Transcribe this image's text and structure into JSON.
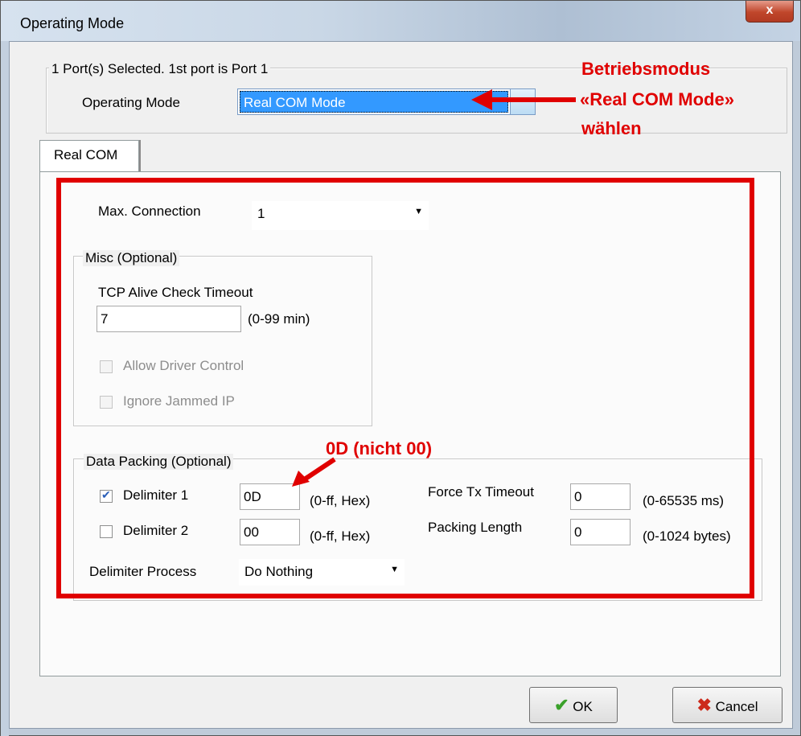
{
  "window": {
    "title": "Operating Mode",
    "close_label": "x"
  },
  "header": {
    "port_info": "1 Port(s) Selected. 1st port is Port 1",
    "mode_label": "Operating Mode",
    "mode_value": "Real COM Mode"
  },
  "tab": {
    "label": "Real COM"
  },
  "max_connection": {
    "label": "Max. Connection",
    "value": "1"
  },
  "misc": {
    "title": "Misc (Optional)",
    "timeout_label": "TCP Alive Check Timeout",
    "timeout_value": "7",
    "timeout_range": "(0-99 min)",
    "allow_driver_label": "Allow Driver Control",
    "ignore_jammed_label": "Ignore Jammed IP"
  },
  "packing": {
    "title": "Data Packing (Optional)",
    "delim1_label": "Delimiter 1",
    "delim1_value": "0D",
    "delim1_range": "(0-ff, Hex)",
    "delim2_label": "Delimiter 2",
    "delim2_value": "00",
    "delim2_range": "(0-ff, Hex)",
    "force_tx_label": "Force Tx Timeout",
    "force_tx_value": "0",
    "force_tx_range": "(0-65535 ms)",
    "packing_len_label": "Packing Length",
    "packing_len_value": "0",
    "packing_len_range": "(0-1024 bytes)",
    "process_label": "Delimiter Process",
    "process_value": "Do Nothing"
  },
  "buttons": {
    "ok": "OK",
    "cancel": "Cancel"
  },
  "annotations": {
    "mode_line1": "Betriebsmodus",
    "mode_line2": "«Real COM Mode»",
    "mode_line3": "wählen",
    "delimiter_note": "0D (nicht 00)",
    "color": "#e00000"
  },
  "icons": {
    "ok": "checkmark-icon",
    "cancel": "x-icon",
    "dropdown": "chevron-down-icon"
  }
}
